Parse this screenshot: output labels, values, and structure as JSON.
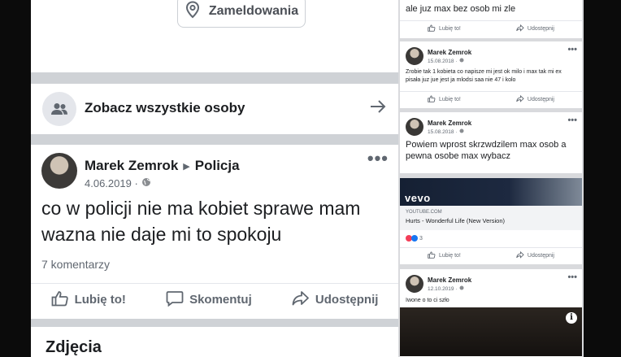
{
  "left_panel": {
    "checkin_button": {
      "label": "Zameldowania",
      "icon": "location-pin-icon"
    },
    "see_all_people": {
      "label": "Zobacz wszystkie osoby",
      "icon": "people-icon",
      "arrow_icon": "arrow-right-icon"
    },
    "post": {
      "author": "Marek Zemrok",
      "target": "Policja",
      "date": "4.06.2019 ·",
      "text": "co w policji nie ma kobiet sprawe mam wazna nie daje mi to spokoju",
      "comments": "7 komentarzy",
      "actions": {
        "like": "Lubię to!",
        "comment": "Skomentuj",
        "share": "Udostępnij"
      }
    },
    "photos_heading": "Zdjęcia"
  },
  "right_panel": {
    "card1": {
      "text": "ale juz max bez osob mi zle",
      "actions": {
        "like": "Lubię to!",
        "share": "Udostępnij"
      }
    },
    "card2": {
      "author": "Marek Zemrok",
      "date": "15.08.2018 ·",
      "text": "Zrobie tak 1 kobieta co napisze mi jest ok milo i max tak mi ex pisała juz jue jest ja mlodsi saa nie 47 i kolo",
      "actions": {
        "like": "Lubię to!",
        "share": "Udostępnij"
      }
    },
    "card3": {
      "author": "Marek Zemrok",
      "date": "15.08.2018 ·",
      "text": "Powiem wprost skrzwdzilem max osob a pewna osobe max wybacz"
    },
    "card4": {
      "brand": "vevo",
      "source": "YOUTUBE.COM",
      "title": "Hurts - Wonderful Life (New Version)",
      "reaction_count": "3",
      "actions": {
        "like": "Lubię to!",
        "share": "Udostępnij"
      }
    },
    "card5": {
      "author": "Marek Zemrok",
      "date": "12.10.2019 ·",
      "text": "Iwone o to ci szło",
      "info_icon_glyph": "i"
    }
  },
  "colors": {
    "background": "#0b0b0b",
    "card": "#ffffff",
    "divider": "#cfd2d6",
    "secondary_text": "#606770",
    "like_blue": "#1877f2",
    "love_red": "#f33e58"
  }
}
